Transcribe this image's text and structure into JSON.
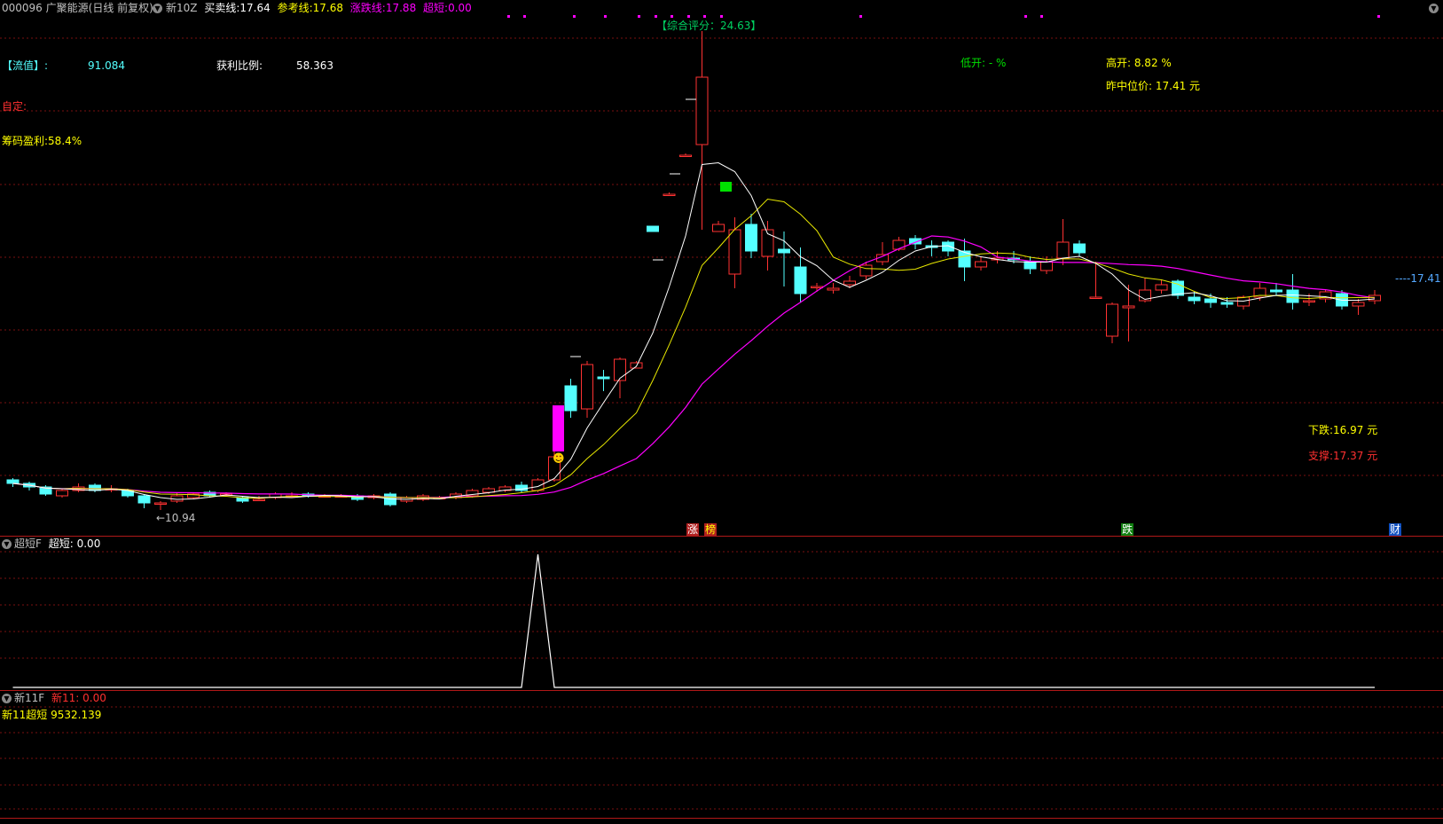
{
  "header": {
    "stock_code": "000096",
    "stock_name": "广聚能源",
    "period": "(日线 前复权)",
    "indicator_name": "新10Z",
    "buy_sell_label": "买卖线:",
    "buy_sell_value": "17.64",
    "ref_label": "参考线:",
    "ref_value": "17.68",
    "updown_label": "涨跌线:",
    "updown_value": "17.88",
    "ultra_label": "超短:",
    "ultra_value": "0.00"
  },
  "panel_info": {
    "rating": "【综合评分：24.63】",
    "float_label": "【流值】:",
    "float_value": "91.084",
    "profit_ratio_label": "获利比例:",
    "profit_ratio_value": "58.363",
    "low_open": "低开: - %",
    "high_open": "高开:  8.82 %",
    "yesterday_mid": "昨中位价:  17.41 元",
    "custom_label": "自定:",
    "chip_profit": "筹码盈利:58.4%",
    "down_label": "下跌:16.97 元",
    "support_label": "支撑:17.37 元",
    "low_marker": "←10.94",
    "last_price_marker": "----17.41",
    "bottom_tags": [
      "涨",
      "榜",
      "跌",
      "财"
    ]
  },
  "sub1": {
    "name": "超短F",
    "value_label": "超短:",
    "value": "0.00"
  },
  "sub2": {
    "name": "新11F",
    "value_label": "新11:",
    "value": "0.00",
    "line2": "新11超短 9532.139"
  },
  "colors": {
    "up": "#ff3232",
    "down": "#54ffff",
    "ma_white": "#ffffff",
    "ma_yellow": "#e8e800",
    "ma_magenta": "#ff00ff",
    "grid": "#7a1010",
    "separator": "#b01818"
  },
  "chart_data": {
    "type": "candlestick",
    "candles": [
      [
        17,
        15,
        18,
        13
      ],
      [
        15,
        13,
        16,
        11
      ],
      [
        13,
        9,
        14,
        8
      ],
      [
        8,
        11,
        12,
        7
      ],
      [
        11,
        13,
        15,
        10
      ],
      [
        14,
        11,
        15,
        10
      ],
      [
        12,
        12,
        14,
        10
      ],
      [
        11,
        8,
        12,
        7
      ],
      [
        8,
        4,
        9,
        1
      ],
      [
        4,
        4,
        5,
        0
      ],
      [
        5,
        8,
        10,
        4
      ],
      [
        7,
        9,
        10,
        6
      ],
      [
        10,
        8,
        11,
        7
      ],
      [
        9,
        9,
        10,
        8
      ],
      [
        7,
        5,
        8,
        4
      ],
      [
        6,
        6,
        8,
        5
      ],
      [
        7,
        9,
        10,
        6
      ],
      [
        8,
        8,
        10,
        7
      ],
      [
        9,
        8,
        10,
        7
      ],
      [
        8,
        8,
        9,
        7
      ],
      [
        8,
        8,
        9,
        7
      ],
      [
        8,
        6,
        9,
        5
      ],
      [
        7,
        8,
        9,
        6
      ],
      [
        9,
        3,
        10,
        2
      ],
      [
        5,
        7,
        8,
        4
      ],
      [
        6,
        8,
        9,
        5
      ],
      [
        7,
        7,
        8,
        6
      ],
      [
        7,
        9,
        10,
        6
      ],
      [
        8,
        11,
        12,
        7
      ],
      [
        10,
        12,
        13,
        9
      ],
      [
        11,
        13,
        14,
        10
      ],
      [
        14,
        11,
        16,
        10
      ],
      [
        11,
        17,
        18,
        10
      ],
      [
        17,
        30,
        34,
        16
      ],
      [
        70,
        56,
        74,
        52
      ],
      [
        57,
        82,
        84,
        52
      ],
      [
        75,
        74,
        79,
        67
      ],
      [
        73,
        85,
        86,
        63
      ],
      [
        80,
        83,
        84,
        80
      ],
      [
        160,
        157,
        158,
        157
      ],
      [
        178,
        178,
        179,
        178
      ],
      [
        200,
        200,
        201,
        200
      ],
      [
        206,
        244,
        270,
        158
      ],
      [
        157,
        161,
        163,
        157
      ],
      [
        133,
        158,
        165,
        125
      ],
      [
        161,
        146,
        167,
        142
      ],
      [
        143,
        158,
        163,
        135
      ],
      [
        147,
        145,
        157,
        126
      ],
      [
        137,
        122,
        148,
        117
      ],
      [
        126,
        126,
        128,
        123
      ],
      [
        124,
        125,
        128,
        122
      ],
      [
        127,
        129,
        132,
        125
      ],
      [
        132,
        138,
        140,
        130
      ],
      [
        140,
        144,
        151,
        138
      ],
      [
        147,
        152,
        154,
        146
      ],
      [
        153,
        150,
        155,
        147
      ],
      [
        149,
        148,
        152,
        143
      ],
      [
        151,
        146,
        152,
        143
      ],
      [
        146,
        137,
        153,
        129
      ],
      [
        137,
        140,
        143,
        135
      ],
      [
        141,
        142,
        146,
        139
      ],
      [
        142,
        141,
        146,
        139
      ],
      [
        140,
        136,
        143,
        133
      ],
      [
        135,
        140,
        143,
        133
      ],
      [
        142,
        151,
        164,
        138
      ],
      [
        150,
        145,
        152,
        143
      ],
      [
        120,
        120,
        140,
        120
      ],
      [
        98,
        116,
        117,
        94
      ],
      [
        114,
        115,
        127,
        95
      ],
      [
        118,
        124,
        131,
        117
      ],
      [
        124,
        127,
        130,
        122
      ],
      [
        129,
        121,
        130,
        119
      ],
      [
        120,
        118,
        123,
        116
      ],
      [
        119,
        117,
        122,
        114
      ],
      [
        117,
        116,
        120,
        114
      ],
      [
        115,
        120,
        121,
        113
      ],
      [
        120,
        125,
        128,
        118
      ],
      [
        124,
        123,
        128,
        121
      ],
      [
        124,
        117,
        133,
        113
      ],
      [
        118,
        118,
        122,
        115
      ],
      [
        119,
        123,
        124,
        117
      ],
      [
        122,
        115,
        124,
        113
      ],
      [
        115,
        117,
        119,
        110
      ],
      [
        118,
        121,
        124,
        116
      ]
    ],
    "ultra_short_peak_index": 32
  }
}
